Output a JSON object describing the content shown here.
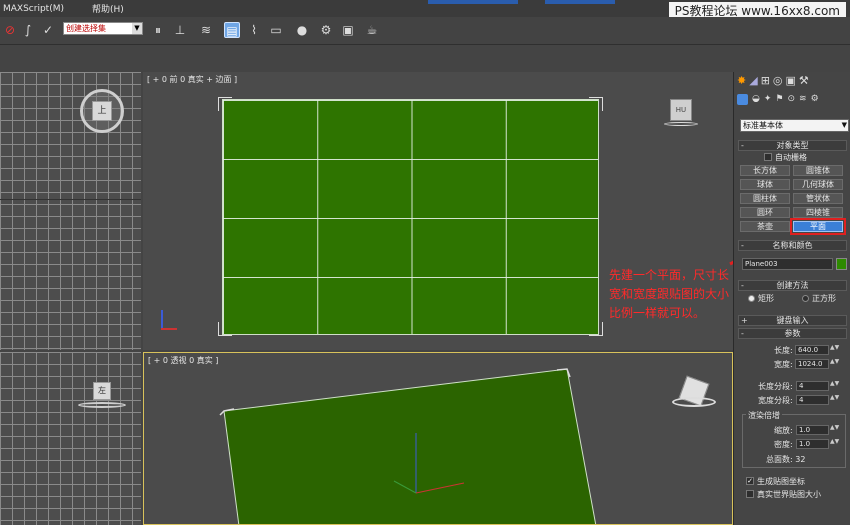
{
  "menu": {
    "items": [
      "MAXScript(M)",
      "帮助(H)"
    ]
  },
  "watermark": "PS教程论坛 www.16xx8.com",
  "toolbar": {
    "selection_set": "创建选择集"
  },
  "viewports": {
    "front": {
      "label": "[ + 0 前 0 真实 + 边面 ]"
    },
    "perspective": {
      "label": "[ + 0 透视 0 真实 ]"
    },
    "top_cube": "上",
    "left_cube": "左",
    "front_cube": "前"
  },
  "command_panel": {
    "category": "标准基本体",
    "object_type": {
      "title": "对象类型",
      "autogrid": "自动栅格",
      "buttons": [
        "长方体",
        "圆锥体",
        "球体",
        "几何球体",
        "圆柱体",
        "管状体",
        "圆环",
        "四棱锥",
        "茶壶",
        "平面"
      ],
      "active": "平面"
    },
    "name_color": {
      "title": "名称和颜色",
      "name": "Plane003",
      "swatch": "#2e8a00"
    },
    "creation_method": {
      "title": "创建方法",
      "options": [
        "矩形",
        "正方形"
      ],
      "selected": "矩形"
    },
    "keyboard_entry": {
      "title": "键盘输入"
    },
    "parameters": {
      "title": "参数",
      "length_label": "长度:",
      "length": "640.0",
      "width_label": "宽度:",
      "width": "1024.0",
      "length_segs_label": "长度分段:",
      "length_segs": "4",
      "width_segs_label": "宽度分段:",
      "width_segs": "4",
      "render_mult_title": "渲染倍增",
      "scale_label": "缩放:",
      "scale": "1.0",
      "density_label": "密度:",
      "density": "1.0",
      "total_faces": "总面数: 32",
      "gen_mapping": "生成贴图坐标",
      "real_world": "真实世界贴图大小"
    }
  },
  "annotation": "先建一个平面，尺寸长宽和宽度跟贴图的大小比例一样就可以。",
  "colors": {
    "plane": "#2e7400",
    "accent": "#3b7fd6",
    "annotation": "#ff2a2a"
  }
}
